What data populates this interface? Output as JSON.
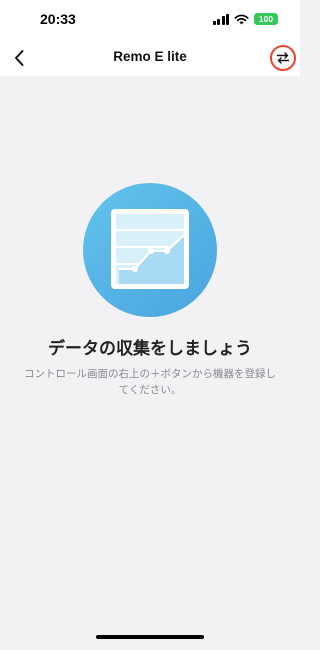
{
  "status_bar": {
    "time": "20:33",
    "battery_level": "100",
    "battery_color": "#34c759"
  },
  "nav": {
    "title": "Remo E lite",
    "back_icon": "chevron-left-icon",
    "switch_icon": "swap-arrows-icon",
    "highlight_color": "#e8452c"
  },
  "empty_state": {
    "icon": "chart-icon",
    "title": "データの収集をしましょう",
    "description": "コントロール画面の右上の＋ボタンから機器を登録してください。"
  }
}
